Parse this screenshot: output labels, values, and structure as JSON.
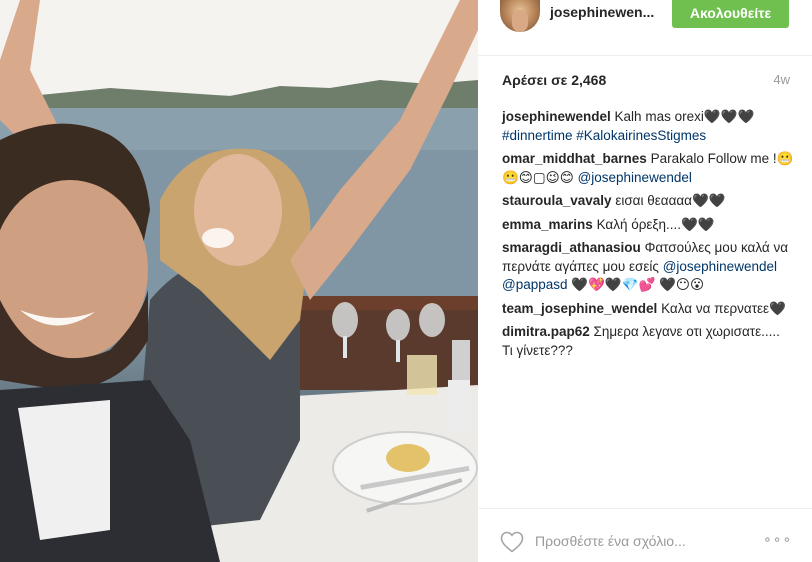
{
  "post": {
    "username": "josephinewen...",
    "follow_label": "Ακολουθείτε",
    "likes_text": "Αρέσει σε 2,468",
    "age": "4w"
  },
  "comments": [
    {
      "user": "josephinewendel",
      "text": "Kalh mas orexi🖤🖤🖤",
      "links": "#dinnertime #KalokairinesStigmes"
    },
    {
      "user": "omar_middhat_barnes",
      "text": "Parakalo Follow me !😬😬😊▢😉😊",
      "links": "@josephinewendel"
    },
    {
      "user": "stauroula_vavaly",
      "text": "εισαι θεαααα🖤🖤",
      "links": ""
    },
    {
      "user": "emma_marins",
      "text": "Καλή όρεξη....🖤🖤",
      "links": ""
    },
    {
      "user": "smaragdi_athanasiou",
      "text": "Φατσούλες μου καλά να περνάτε αγάπες μου εσείς",
      "links": "@josephinewendel @pappasd",
      "tail": "🖤💖🖤💎💕 🖤😶😮"
    },
    {
      "user": "team_josephine_wendel",
      "text": "Καλα να περνατεε🖤",
      "links": ""
    },
    {
      "user": "dimitra.pap62",
      "text": "Σημερα λεγανε οτι χωρισατε..... Τι γίνετε???",
      "links": ""
    }
  ],
  "footer": {
    "placeholder": "Προσθέστε ένα σχόλιο...",
    "more_label": "∘∘∘"
  },
  "icons": {
    "heart": "heart-outline-icon",
    "more": "more-options-icon"
  },
  "colors": {
    "follow_green": "#70c050",
    "link_blue": "#003569"
  }
}
